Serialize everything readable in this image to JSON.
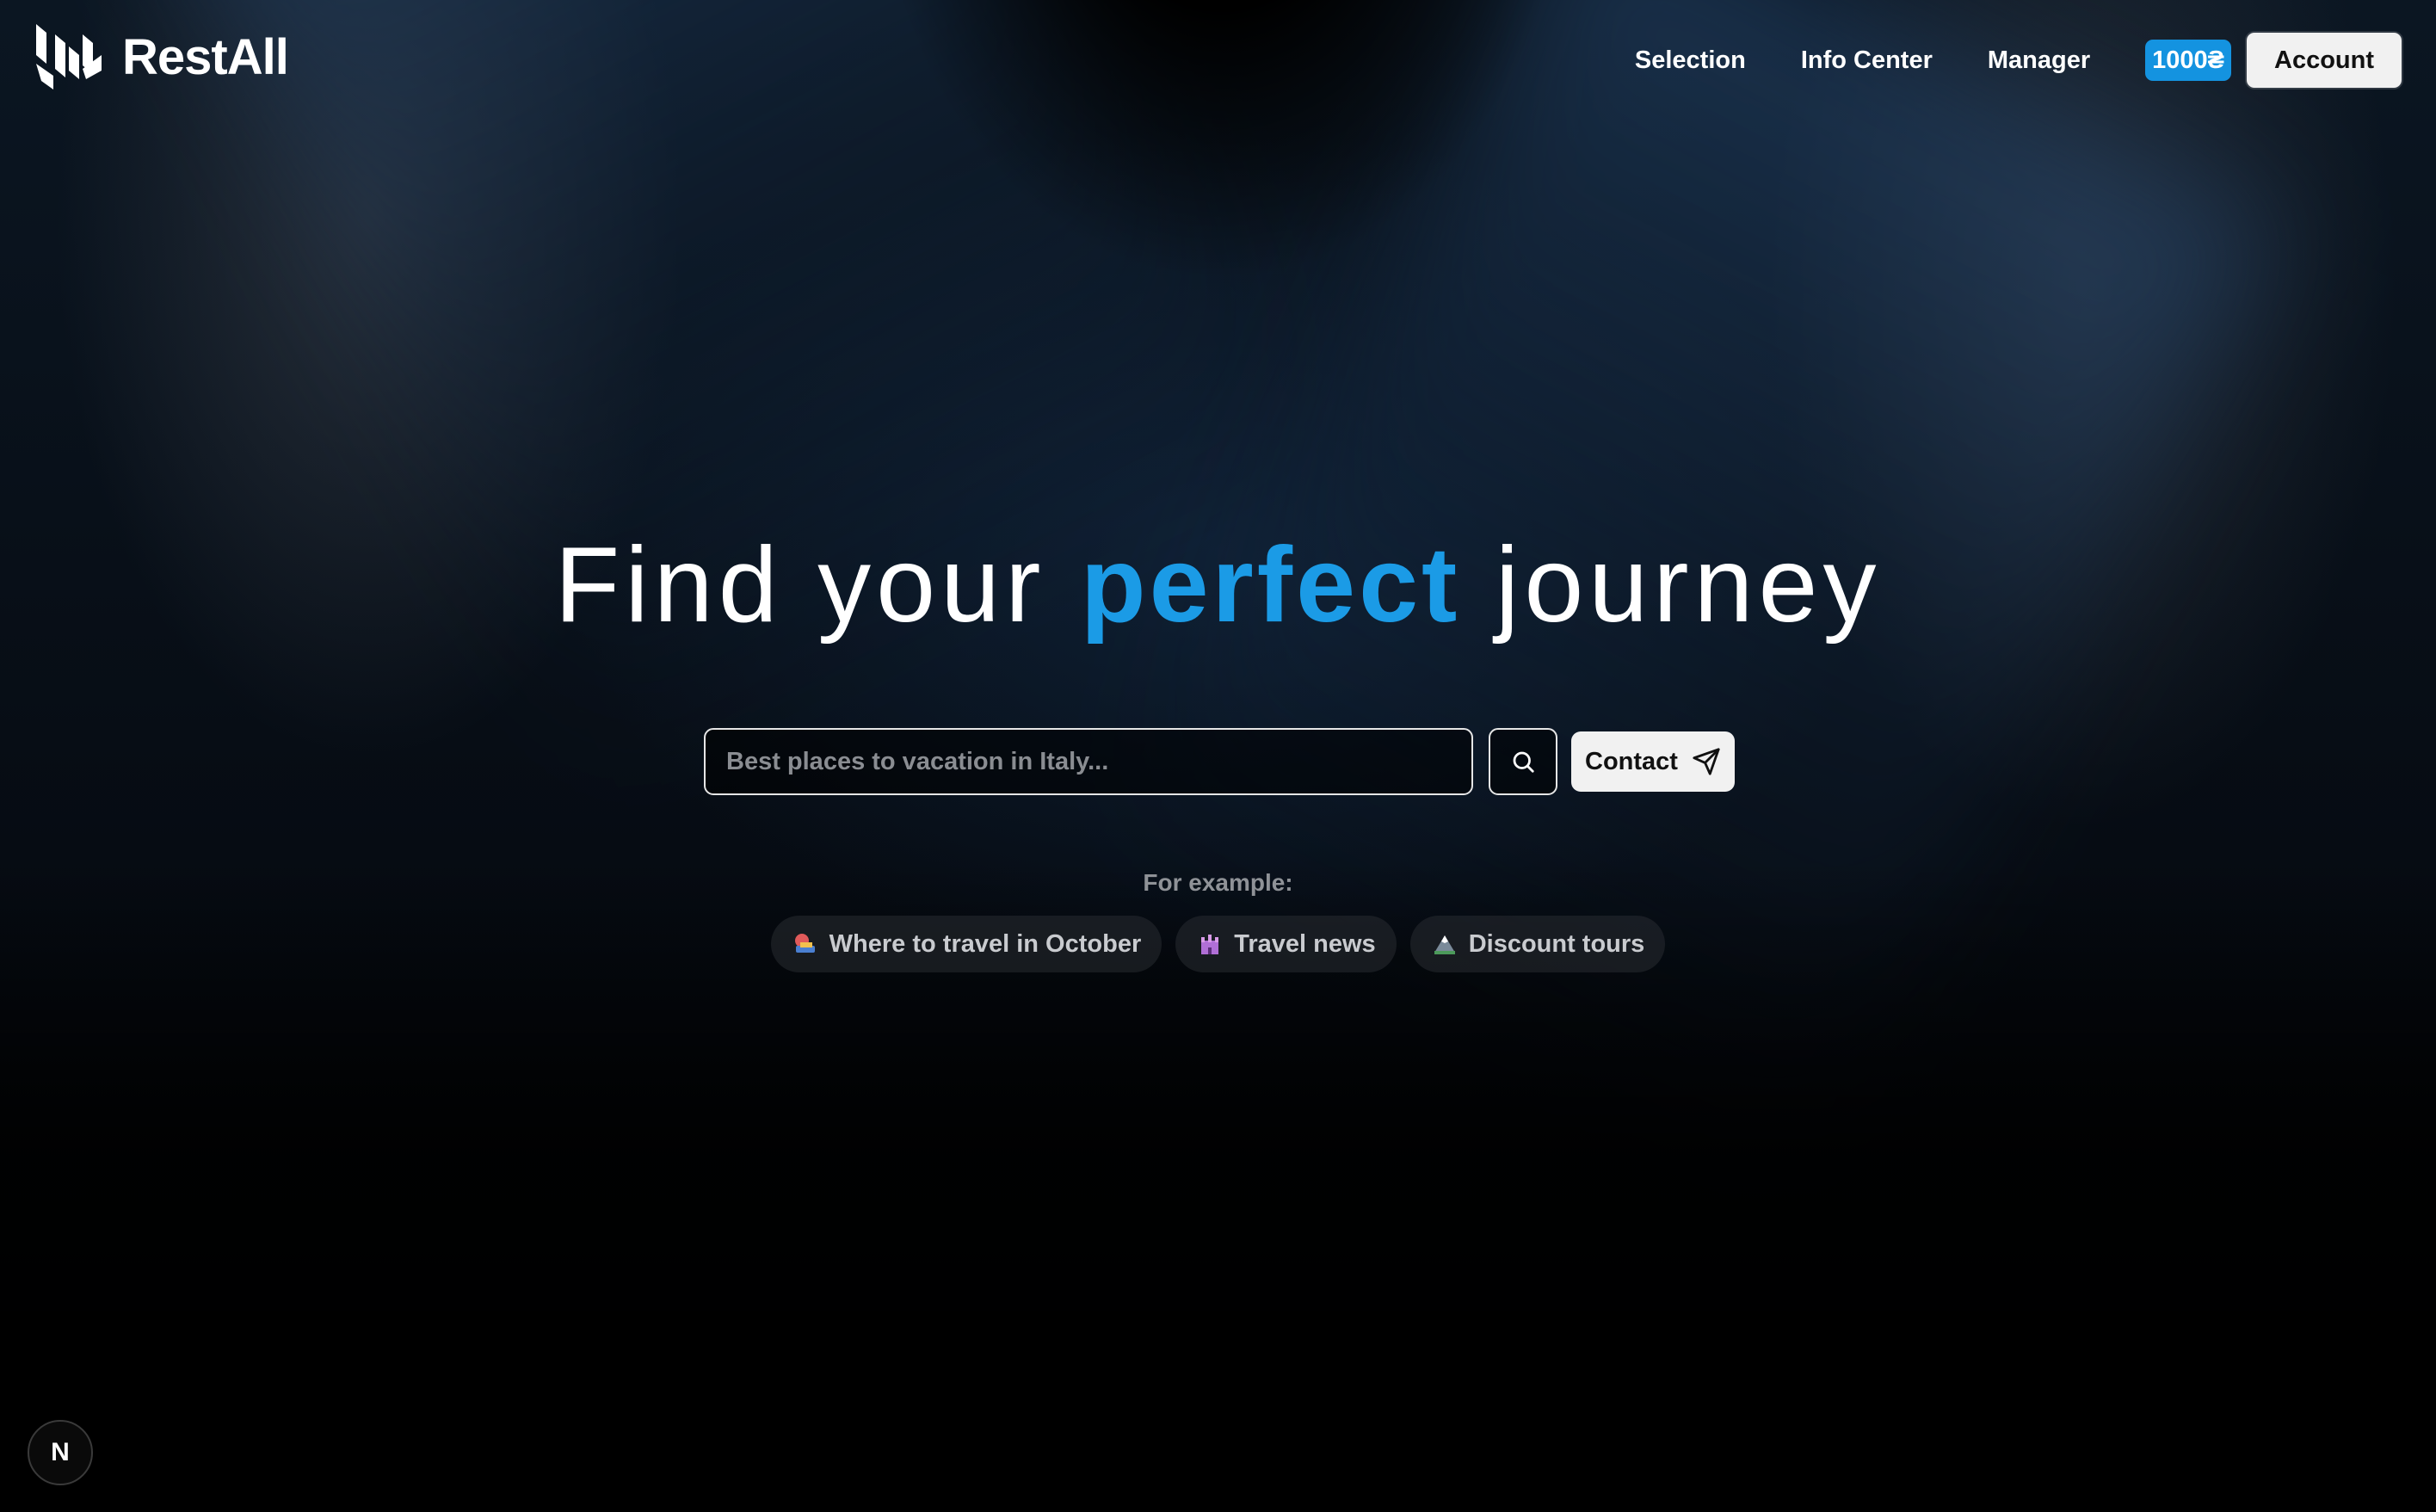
{
  "header": {
    "logo_text": "RestAll",
    "nav": [
      {
        "label": "Selection"
      },
      {
        "label": "Info Center"
      },
      {
        "label": "Manager"
      }
    ],
    "balance": "1000₴",
    "account_label": "Account"
  },
  "hero": {
    "title_before": "Find your",
    "title_accent": "perfect",
    "title_after": "journey"
  },
  "search": {
    "placeholder": "Best places to vacation in Italy...",
    "value": "",
    "contact_label": "Contact"
  },
  "examples": {
    "label": "For example:",
    "chips": [
      {
        "label": "Where to travel in October",
        "icon": "travel-icon"
      },
      {
        "label": "Travel news",
        "icon": "castle-icon"
      },
      {
        "label": "Discount tours",
        "icon": "mountain-icon"
      }
    ]
  },
  "badge": {
    "letter": "N"
  },
  "colors": {
    "accent": "#1b9be6",
    "balance_bg": "#1493e0",
    "button_bg": "#f1f1f1",
    "background": "#000000"
  }
}
